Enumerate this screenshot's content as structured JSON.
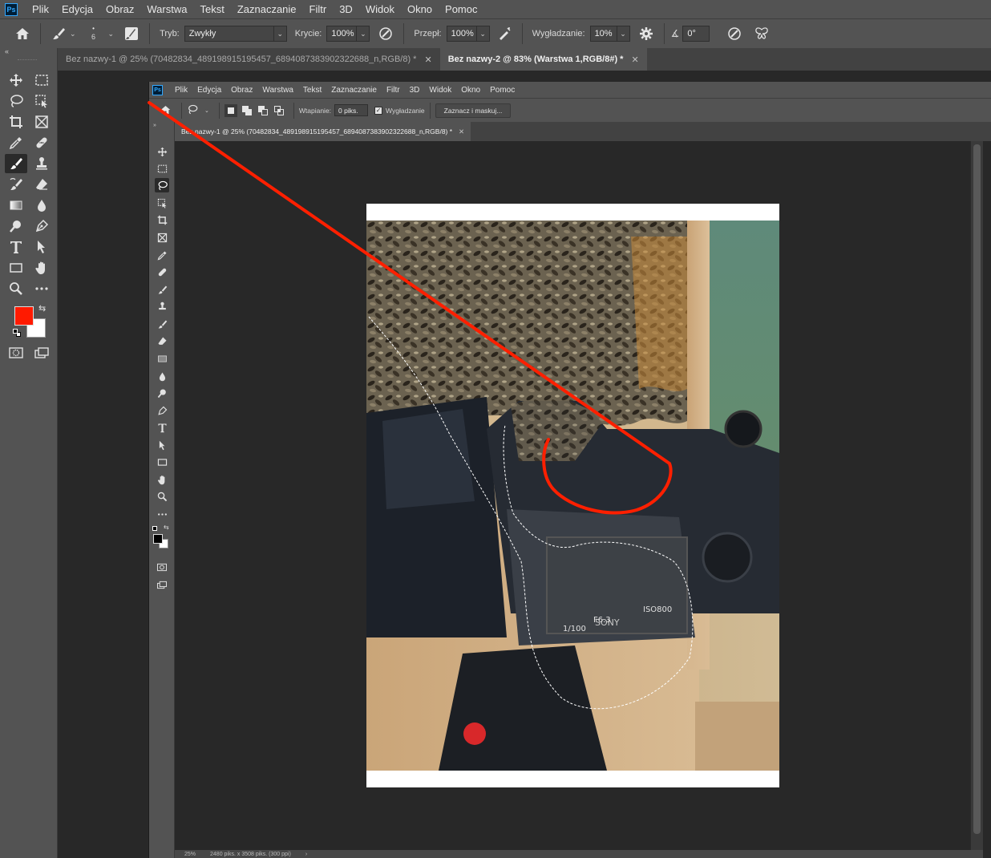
{
  "app": {
    "logo": "Ps",
    "menu": [
      "Plik",
      "Edycja",
      "Obraz",
      "Warstwa",
      "Tekst",
      "Zaznaczanie",
      "Filtr",
      "3D",
      "Widok",
      "Okno",
      "Pomoc"
    ]
  },
  "options": {
    "brush_size": "6",
    "mode_label": "Tryb:",
    "mode_value": "Zwykły",
    "opacity_label": "Krycie:",
    "opacity_value": "100%",
    "flow_label": "Przepł:",
    "flow_value": "100%",
    "smoothing_label": "Wygładzanie:",
    "smoothing_value": "10%",
    "angle_value": "0°"
  },
  "tabs": [
    {
      "label": "Bez nazwy-1 @ 25% (70482834_489198915195457_6894087383902322688_n,RGB/8) *",
      "active": false
    },
    {
      "label": "Bez nazwy-2 @ 83% (Warstwa 1,RGB/8#) *",
      "active": true
    }
  ],
  "colors": {
    "foreground": "#ff1a00",
    "background": "#ffffff",
    "annotation_stroke": "#ff1f00"
  },
  "inner": {
    "logo": "Ps",
    "menu": [
      "Plik",
      "Edycja",
      "Obraz",
      "Warstwa",
      "Tekst",
      "Zaznaczanie",
      "Filtr",
      "3D",
      "Widok",
      "Okno",
      "Pomoc"
    ],
    "options": {
      "feather_label": "Wtapianie:",
      "feather_value": "0 piks.",
      "antialias_label": "Wygładzanie",
      "select_mask_button": "Zaznacz i maskuj..."
    },
    "tab": "Bez nazwy-1 @ 25% (70482834_489198915195457_6894087383902322688_n,RGB/8) *",
    "status": {
      "zoom": "25%",
      "doc_size": "2480 piks. x 3508 piks. (300 ppi)"
    }
  },
  "photo_text": {
    "brand": "SONY",
    "aperture": "F6.3",
    "shutter": "1/100",
    "iso": "ISO800"
  }
}
